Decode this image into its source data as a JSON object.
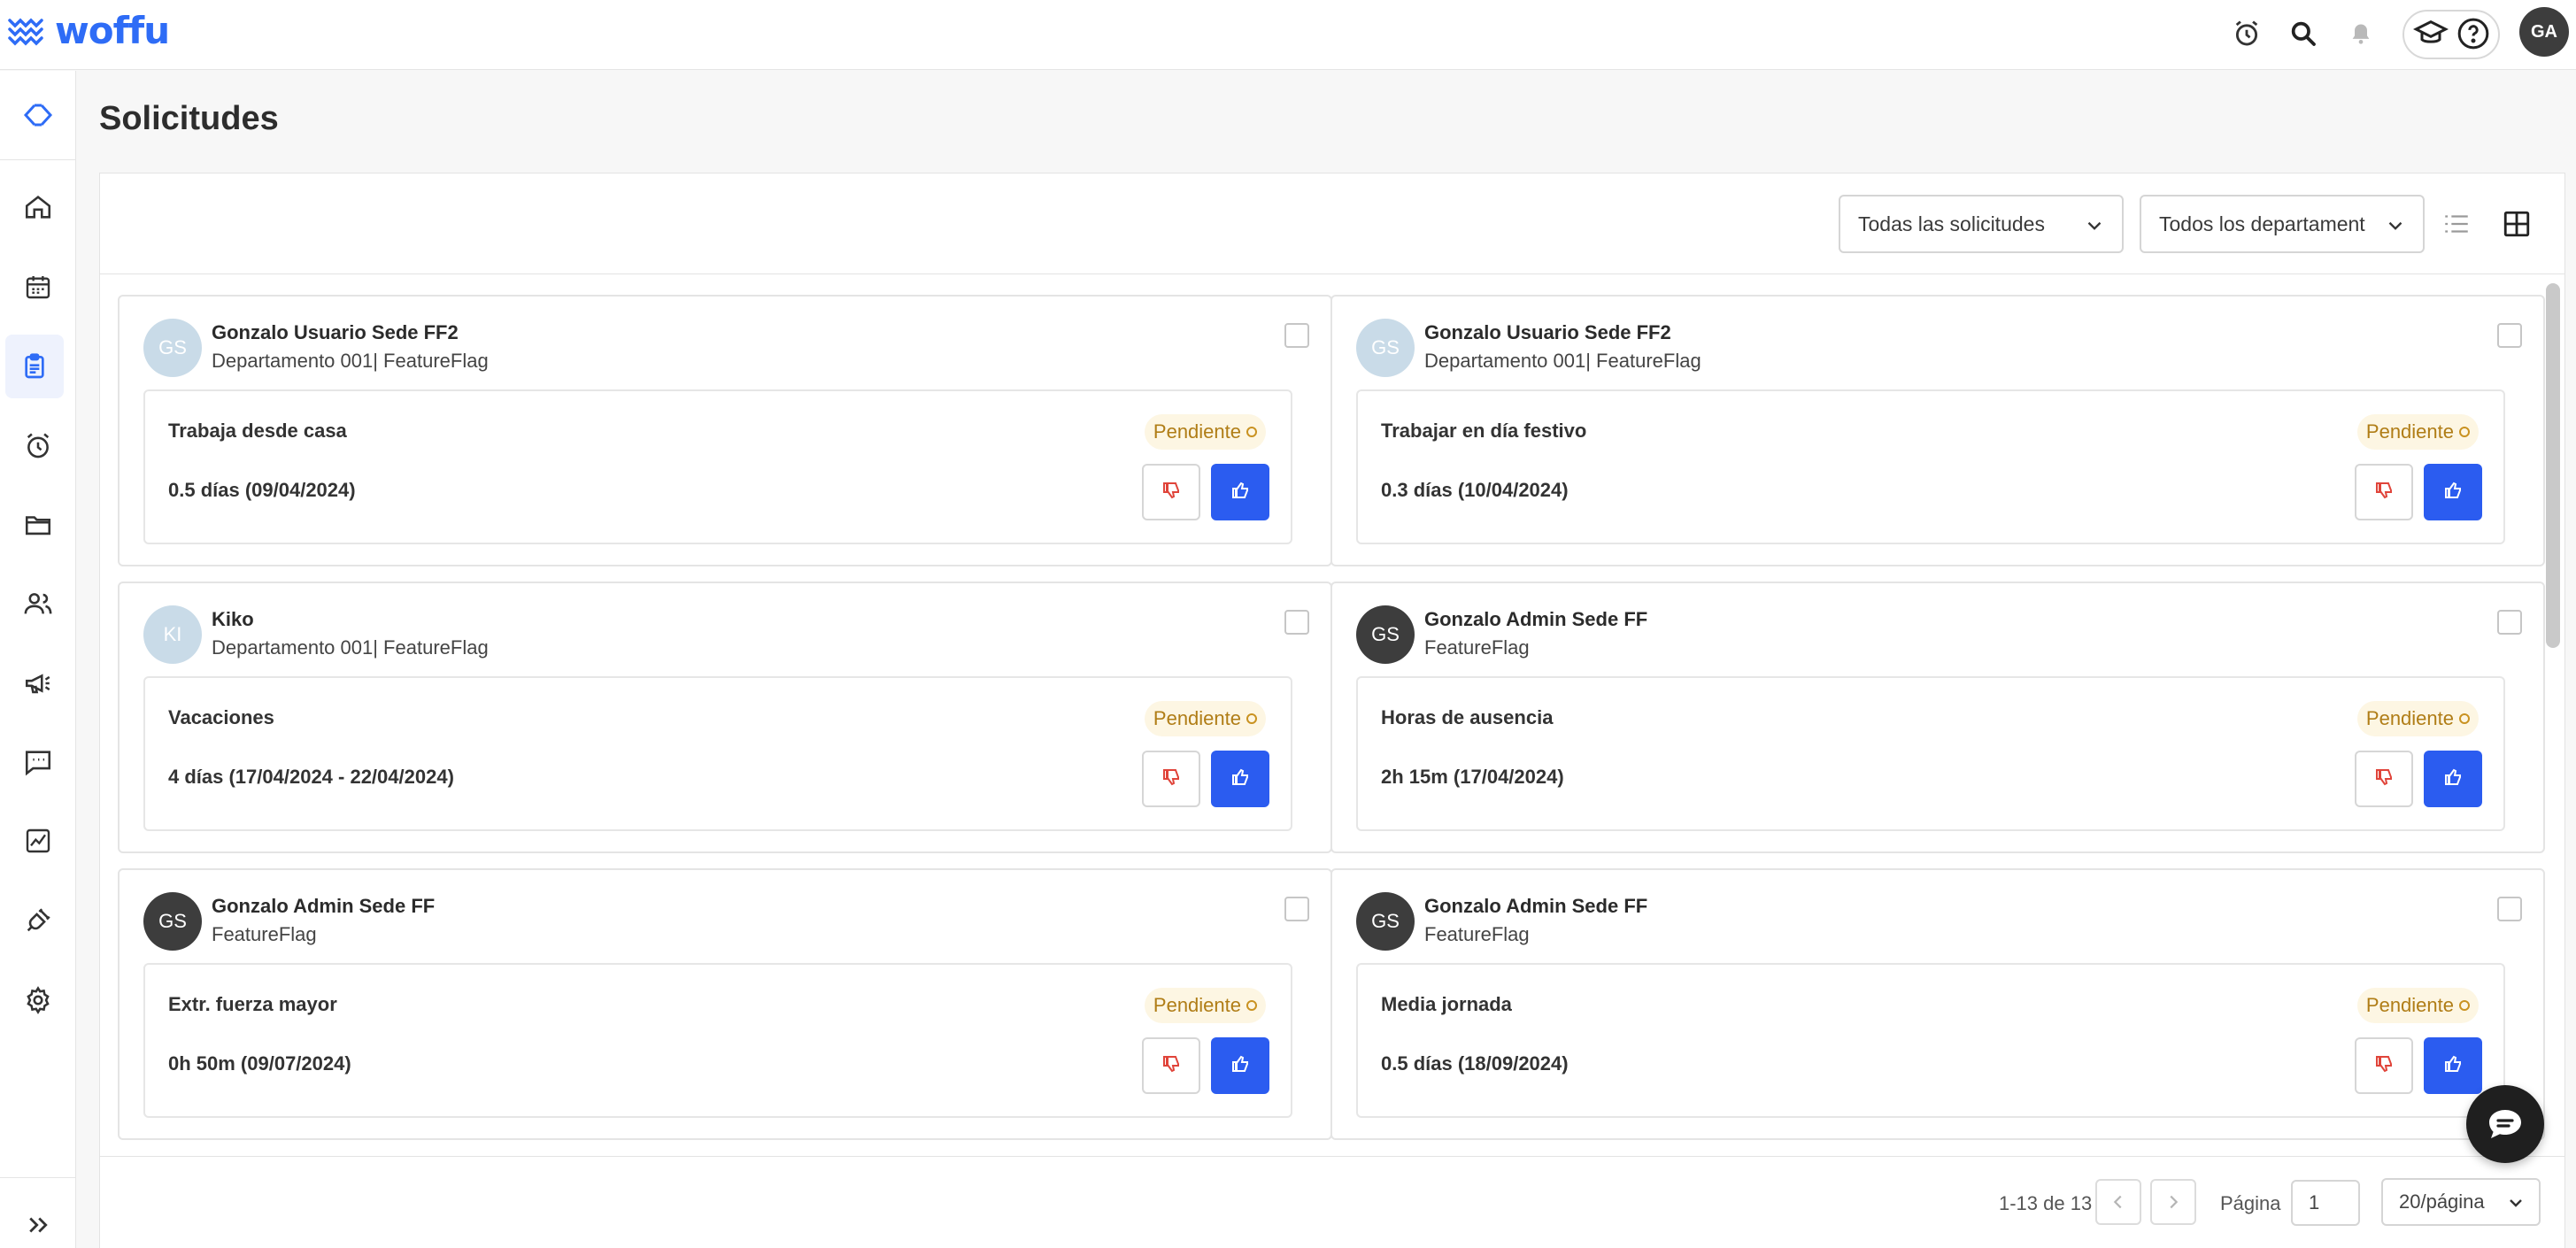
{
  "app": {
    "logo_text": "woffu",
    "brand_color": "#2e6cf6"
  },
  "header": {
    "user_initials": "GA"
  },
  "page": {
    "title": "Solicitudes"
  },
  "filters": {
    "requests": "Todas las solicitudes",
    "departments": "Todos los departament"
  },
  "cards": [
    {
      "initials": "GS",
      "avatar": "light",
      "name": "Gonzalo Usuario Sede FF2",
      "dept": "Departamento 001| FeatureFlag",
      "type": "Trabaja desde casa",
      "duration": "0.5 días (09/04/2024)",
      "status": "Pendiente"
    },
    {
      "initials": "GS",
      "avatar": "light",
      "name": "Gonzalo Usuario Sede FF2",
      "dept": "Departamento 001| FeatureFlag",
      "type": "Trabajar en día festivo",
      "duration": "0.3 días (10/04/2024)",
      "status": "Pendiente"
    },
    {
      "initials": "KI",
      "avatar": "light",
      "name": "Kiko",
      "dept": "Departamento 001| FeatureFlag",
      "type": "Vacaciones",
      "duration": "4 días (17/04/2024 - 22/04/2024)",
      "status": "Pendiente"
    },
    {
      "initials": "GS",
      "avatar": "dark",
      "name": "Gonzalo Admin Sede FF",
      "dept": "FeatureFlag",
      "type": "Horas de ausencia",
      "duration": "2h 15m (17/04/2024)",
      "status": "Pendiente"
    },
    {
      "initials": "GS",
      "avatar": "dark",
      "name": "Gonzalo Admin Sede FF",
      "dept": "FeatureFlag",
      "type": "Extr. fuerza mayor",
      "duration": "0h 50m (09/07/2024)",
      "status": "Pendiente"
    },
    {
      "initials": "GS",
      "avatar": "dark",
      "name": "Gonzalo Admin Sede FF",
      "dept": "FeatureFlag",
      "type": "Media jornada",
      "duration": "0.5 días (18/09/2024)",
      "status": "Pendiente"
    }
  ],
  "pagination": {
    "range": "1-13 de 13",
    "page_label": "Página",
    "page": "1",
    "page_size": "20/página"
  },
  "sidebar": {
    "items": [
      "collapse-logo-icon",
      "home-icon",
      "calendar-icon",
      "requests-icon",
      "alarm-clock-icon",
      "folder-icon",
      "people-icon",
      "megaphone-icon",
      "chat-icon",
      "chart-icon",
      "plug-icon",
      "gear-icon"
    ],
    "expand": "expand-icon"
  }
}
